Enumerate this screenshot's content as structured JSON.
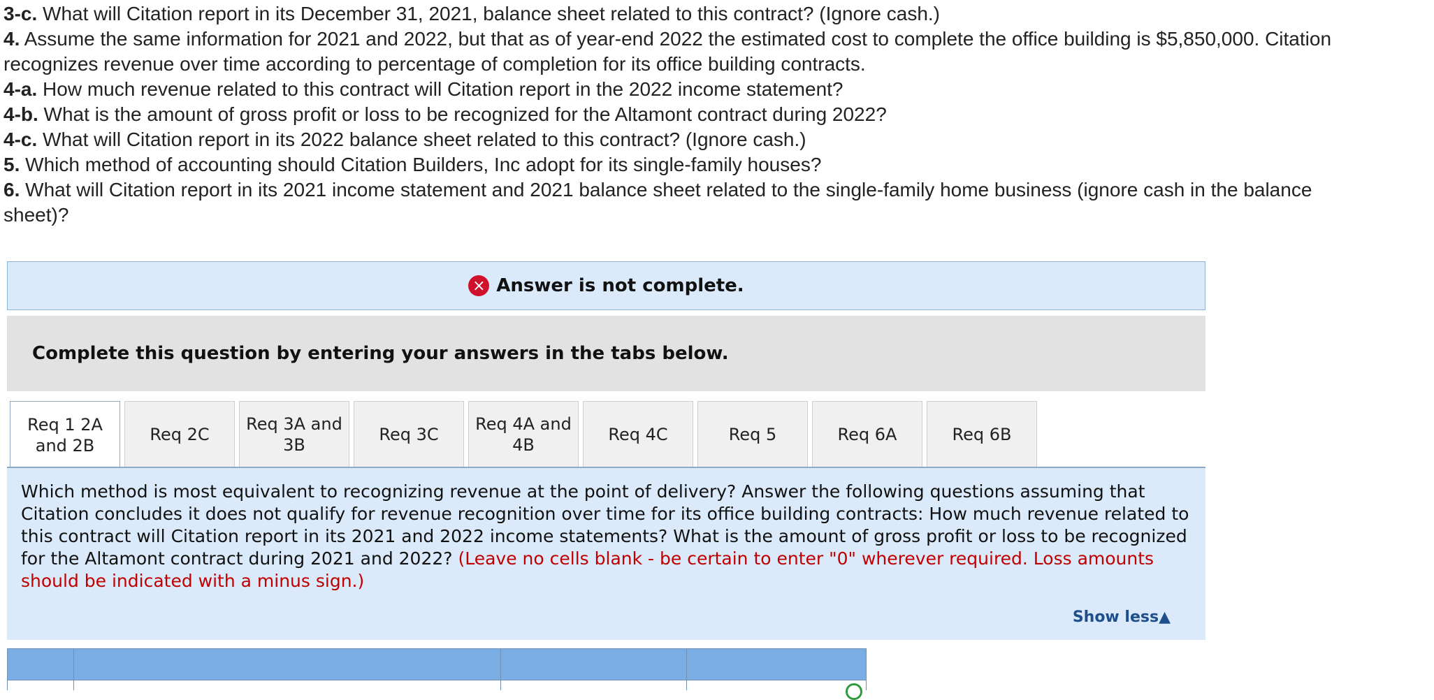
{
  "questions": [
    {
      "num": "3-c.",
      "text": " What will Citation report in its December 31, 2021, balance sheet related to this contract? (Ignore cash.)"
    },
    {
      "num": "4.",
      "text": " Assume the same information for 2021 and 2022, but that as of year-end 2022 the estimated cost to complete the office building is $5,850,000. Citation recognizes revenue over time according to percentage of completion for its office building contracts."
    },
    {
      "num": "4-a.",
      "text": " How much revenue related to this contract will Citation report in the 2022 income statement?"
    },
    {
      "num": "4-b.",
      "text": " What is the amount of gross profit or loss to be recognized for the Altamont contract during 2022?"
    },
    {
      "num": "4-c.",
      "text": " What will Citation report in its 2022 balance sheet related to this contract? (Ignore cash.)"
    },
    {
      "num": "5.",
      "text": " Which method of accounting should Citation Builders, Inc adopt for its single-family houses?"
    },
    {
      "num": "6.",
      "text": " What will Citation report in its 2021 income statement and 2021 balance sheet related to the single-family home business (ignore cash in the balance sheet)?"
    }
  ],
  "status_banner": {
    "icon": "×",
    "text": "Answer is not complete."
  },
  "instruction": "Complete this question by entering your answers in the tabs below.",
  "tabs": [
    "Req 1 2A and 2B",
    "Req 2C",
    "Req 3A and 3B",
    "Req 3C",
    "Req 4A and 4B",
    "Req 4C",
    "Req 5",
    "Req 6A",
    "Req 6B"
  ],
  "active_tab_index": 0,
  "prompt": {
    "text": "Which method is most equivalent to recognizing revenue at the point of delivery? Answer the following questions assuming that Citation concludes it does not qualify for revenue recognition over time for its office building contracts: How much revenue related to this contract will Citation report in its 2021 and 2022 income statements? What is the amount of gross profit or loss to be recognized for the Altamont contract during 2021 and 2022? ",
    "note": "(Leave no cells blank - be certain to enter \"0\" wherever required. Loss amounts should be indicated with a minus sign.)"
  },
  "show_less_label": "Show less",
  "colors": {
    "banner_bg": "#dbeafa",
    "error_red": "#d0112b",
    "note_red": "#c00000",
    "table_header": "#7aade3",
    "link_blue": "#1f4e8c"
  }
}
